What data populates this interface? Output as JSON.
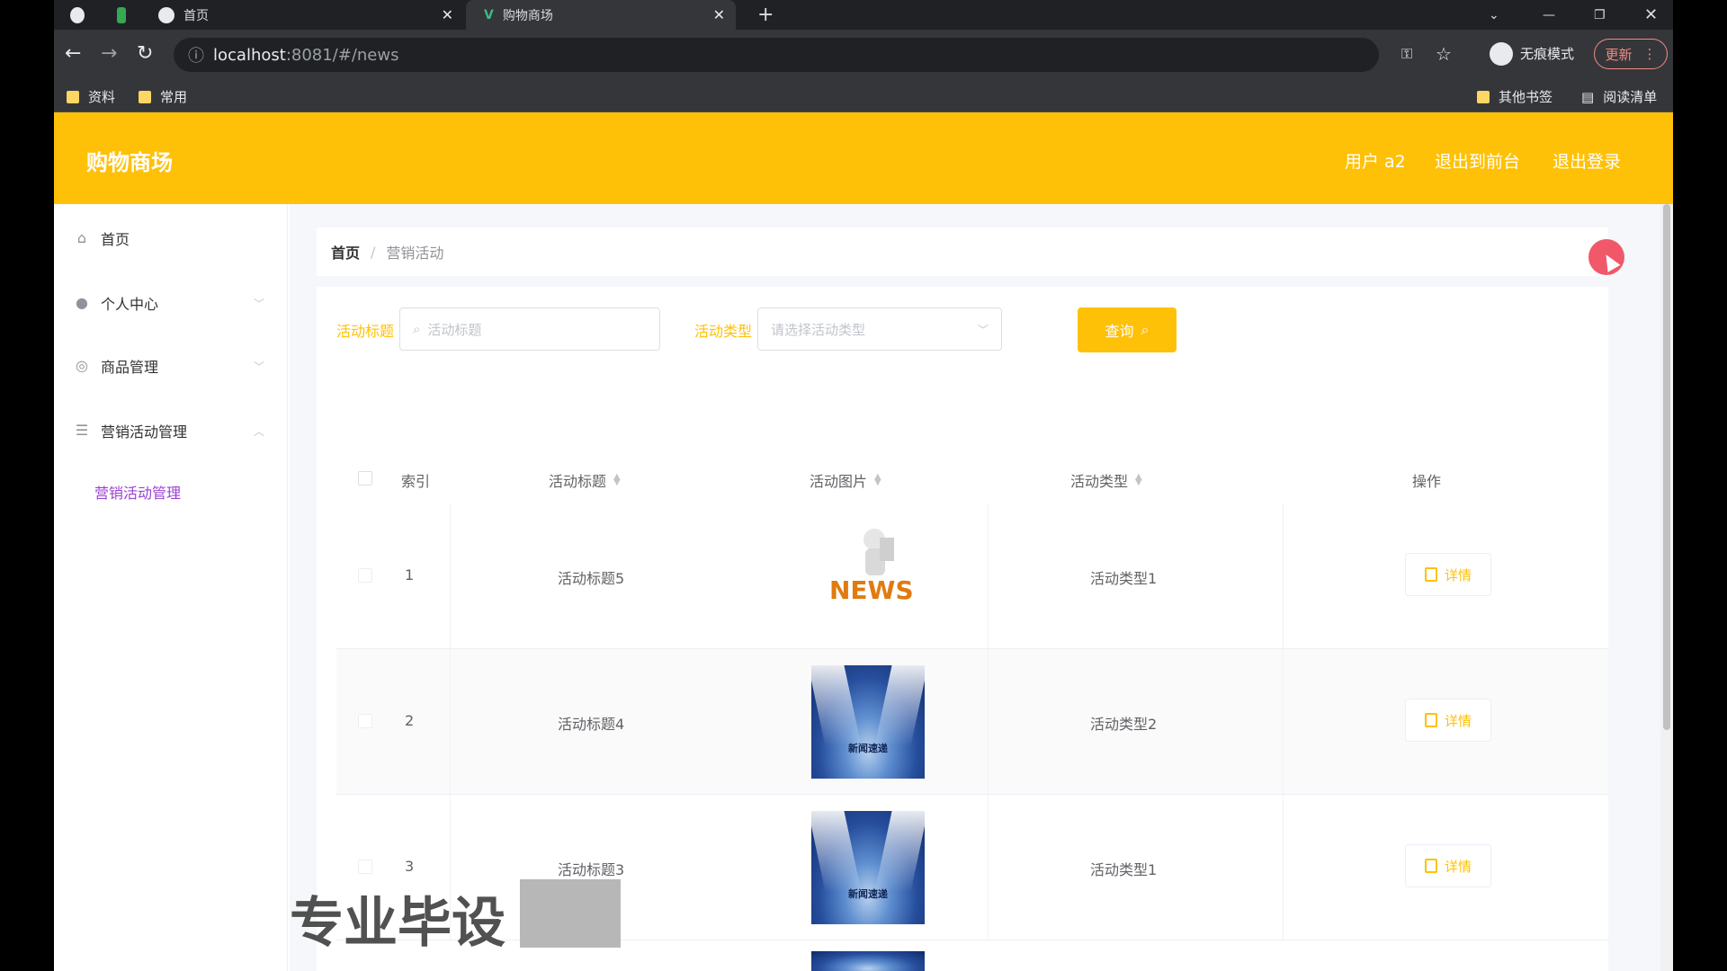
{
  "browser": {
    "tabs": [
      {
        "label": "首页"
      },
      {
        "label": "购物商场"
      }
    ],
    "url_host": "localhost",
    "url_rest": ":8081/#/news",
    "incognito_label": "无痕模式",
    "update_label": "更新",
    "bookmarks_left": [
      "资料",
      "常用"
    ],
    "bookmarks_right": [
      "其他书签",
      "阅读清单"
    ]
  },
  "header": {
    "title": "购物商场",
    "user_label": "用户 a2",
    "back_label": "退出到前台",
    "logout_label": "退出登录"
  },
  "sidebar": {
    "items": [
      {
        "label": "首页",
        "icon": "home-icon"
      },
      {
        "label": "个人中心",
        "icon": "user-icon"
      },
      {
        "label": "商品管理",
        "icon": "goods-icon"
      },
      {
        "label": "营销活动管理",
        "icon": "list-icon"
      }
    ],
    "submenu_label": "营销活动管理"
  },
  "breadcrumb": {
    "home": "首页",
    "current": "营销活动"
  },
  "filters": {
    "title_label": "活动标题",
    "title_placeholder": "活动标题",
    "type_label": "活动类型",
    "type_placeholder": "请选择活动类型",
    "query_button": "查询"
  },
  "table": {
    "headers": {
      "index": "索引",
      "title": "活动标题",
      "image": "活动图片",
      "type": "活动类型",
      "action": "操作"
    },
    "rows": [
      {
        "index": "1",
        "title": "活动标题5",
        "image": "news-figure",
        "type": "活动类型1",
        "action": "详情"
      },
      {
        "index": "2",
        "title": "活动标题4",
        "image": "stage-lights",
        "type": "活动类型2",
        "action": "详情"
      },
      {
        "index": "3",
        "title": "活动标题3",
        "image": "stage-lights",
        "type": "活动类型1",
        "action": "详情"
      }
    ],
    "image_text": "新闻速递"
  },
  "watermark": "专业毕设",
  "colors": {
    "accent": "#ffc107",
    "submenu_active": "#9b3fd3",
    "chrome_dark": "#202124"
  }
}
